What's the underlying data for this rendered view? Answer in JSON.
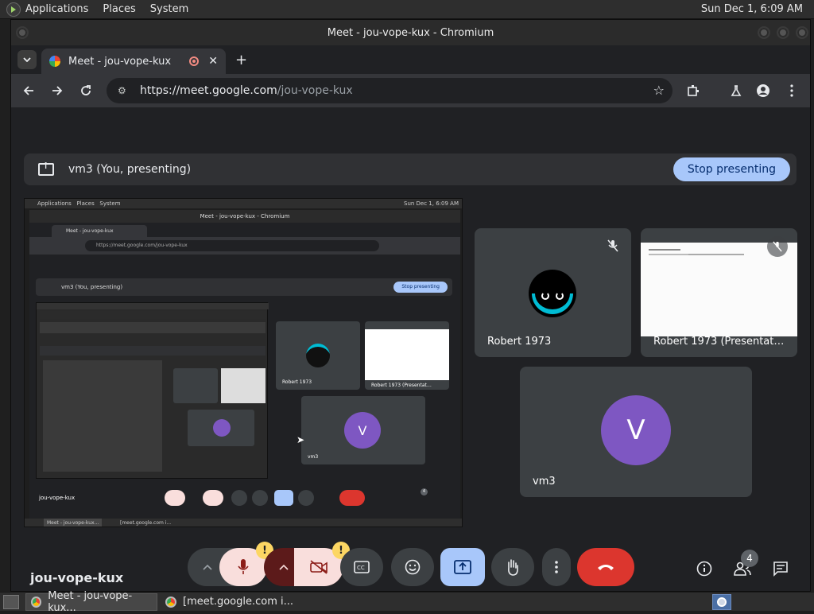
{
  "top_panel": {
    "menus": [
      "Applications",
      "Places",
      "System"
    ],
    "clock": "Sun Dec 1,  6:09 AM"
  },
  "window": {
    "title": "Meet - jou-vope-kux - Chromium"
  },
  "tab": {
    "title": "Meet - jou-vope-kux",
    "close": "✕"
  },
  "toolbar": {
    "url_host": "https://meet.google.com",
    "url_path": "/jou-vope-kux"
  },
  "meet": {
    "presenting_label": "vm3 (You, presenting)",
    "stop_presenting": "Stop presenting",
    "meeting_code": "jou-vope-kux",
    "participants": [
      {
        "name": "Robert 1973"
      },
      {
        "name": "Robert 1973 (Presentat…"
      },
      {
        "name": "vm3",
        "initial": "V"
      }
    ],
    "people_count": "4",
    "warning_badge": "!"
  },
  "shared_screen": {
    "menus": [
      "Applications",
      "Places",
      "System"
    ],
    "clock": "Sun Dec 1, 6:09 AM",
    "window_title": "Meet - jou-vope-kux - Chromium",
    "tab_title": "Meet - jou-vope-kux",
    "url": "https://meet.google.com/jou-vope-kux",
    "presenting_label": "vm3 (You, presenting)",
    "stop_presenting": "Stop presenting",
    "participant_1": "Robert 1973",
    "participant_2": "Robert 1973 (Presentat…",
    "participant_3": "vm3",
    "initial": "V",
    "meeting_code": "jou-vope-kux",
    "people_count": "4",
    "task_1": "Meet - jou-vope-kux...",
    "task_2": "[meet.google.com i..."
  },
  "taskbar": {
    "items": [
      "Meet - jou-vope-kux...",
      "[meet.google.com i..."
    ]
  }
}
